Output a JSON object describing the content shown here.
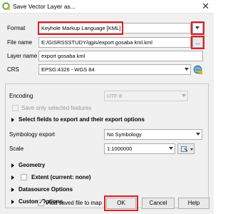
{
  "window": {
    "title": "Save Vector Layer as...",
    "app_icon": "qgis-logo-icon",
    "close_icon": "close-icon"
  },
  "format": {
    "label": "Format",
    "value": "Keyhole Markup Language [KML]"
  },
  "file_name": {
    "label": "File name",
    "value": "E:/GISRSSSTUDY/qgis/export gosaba kml.kml",
    "browse_label": "..."
  },
  "layer_name": {
    "label": "Layer name",
    "value": "export gosaba kml"
  },
  "crs": {
    "label": "CRS",
    "value": "EPSG:4326 - WGS 84",
    "select_icon": "crs-select-icon"
  },
  "encoding": {
    "label": "Encoding",
    "value": "UTF-8"
  },
  "save_selected": {
    "label": "Save only selected features"
  },
  "fields_section": {
    "label": "Select fields to export and their export options"
  },
  "symbology": {
    "label": "Symbology export",
    "value": "No Symbology"
  },
  "scale": {
    "label": "Scale",
    "value": "1:1000000"
  },
  "geometry": {
    "label": "Geometry"
  },
  "extent": {
    "label": "Extent (current: none)"
  },
  "datasource": {
    "label": "Datasource Options"
  },
  "custom": {
    "label": "Custom Options"
  },
  "footer": {
    "add_to_map_label": "Add saved file to map",
    "ok": "OK",
    "cancel": "Cancel",
    "help": "Help"
  },
  "accent": {
    "highlight": "#e01e24"
  }
}
